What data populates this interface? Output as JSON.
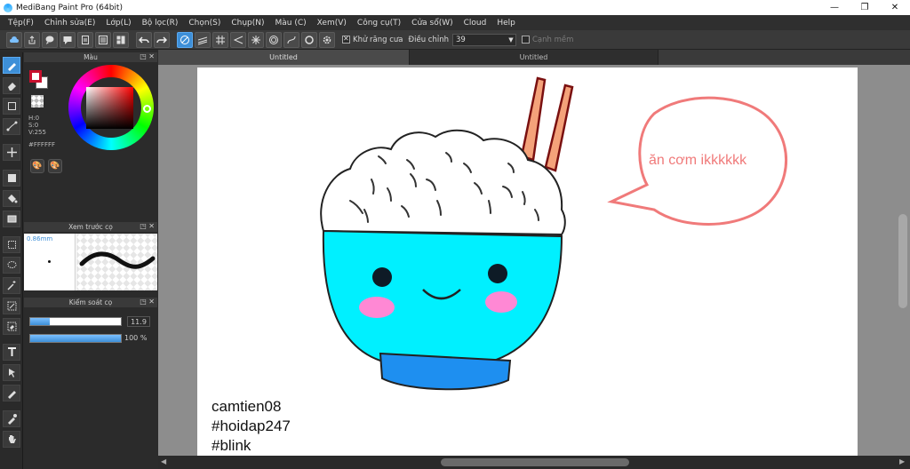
{
  "window": {
    "title": "MediBang Paint Pro (64bit)",
    "controls": [
      "—",
      "❐",
      "✕"
    ]
  },
  "menu": [
    "Tệp(F)",
    "Chỉnh sửa(E)",
    "Lớp(L)",
    "Bộ lọc(R)",
    "Chọn(S)",
    "Chụp(N)",
    "Màu (C)",
    "Xem(V)",
    "Công cụ(T)",
    "Cửa sổ(W)",
    "Cloud",
    "Help"
  ],
  "toolbar": {
    "antialias_label": "Khử răng cưa",
    "correction_label": "Điều chỉnh",
    "correction_value": "39",
    "smooth_label": "Cạnh mềm"
  },
  "tabs": [
    "Untitled",
    "Untitled"
  ],
  "color_panel": {
    "title": "Màu",
    "h": "H:0",
    "s": "S:0",
    "v": "V:255",
    "hex": "#FFFFFF",
    "fg_color": "#c8102e",
    "bg_color": "#ffffff"
  },
  "brush_preview": {
    "title": "Xem trước cọ",
    "size": "0.86mm"
  },
  "brush_control": {
    "title": "Kiểm soát cọ",
    "size_value": "11.9",
    "size_fraction": 0.22,
    "opacity_value": "100 %",
    "opacity_fraction": 1.0
  },
  "canvas": {
    "speech_text": "ăn cơm ikkkkkk",
    "captions": [
      "camtien08",
      "#hoidap247",
      "#blink"
    ]
  }
}
